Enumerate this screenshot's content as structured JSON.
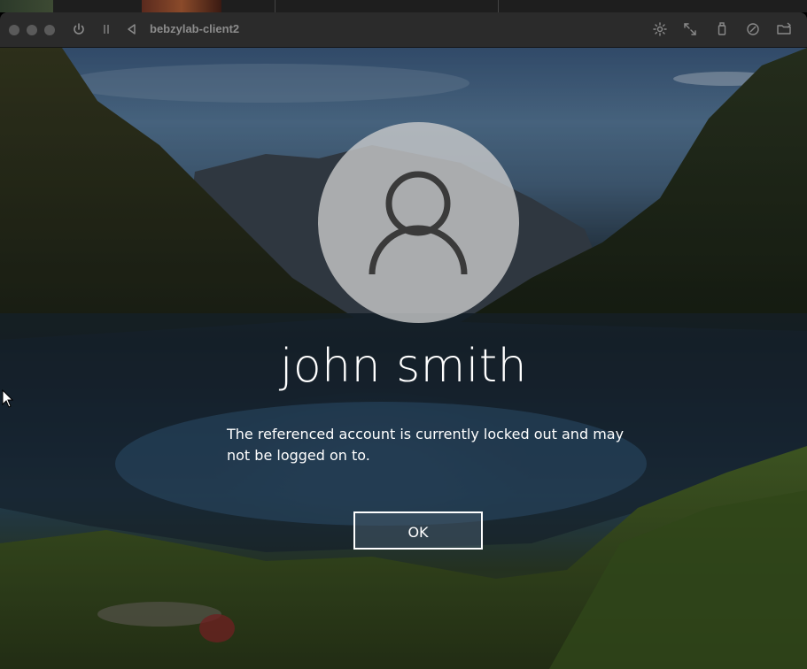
{
  "window": {
    "title": "bebzylab-client2"
  },
  "toolbar": {
    "left_icons": [
      "power-icon",
      "pause-icon",
      "back-icon"
    ],
    "right_icons": [
      "brightness-icon",
      "resize-icon",
      "usb-icon",
      "disc-icon",
      "folder-share-icon"
    ]
  },
  "lock_screen": {
    "username": "john smith",
    "message": "The referenced account is currently locked out and may not be logged on to.",
    "ok_label": "OK"
  },
  "colors": {
    "toolbar_bg": "#2b2b2b",
    "title_text": "#8c8c8c",
    "text": "#ffffff"
  }
}
